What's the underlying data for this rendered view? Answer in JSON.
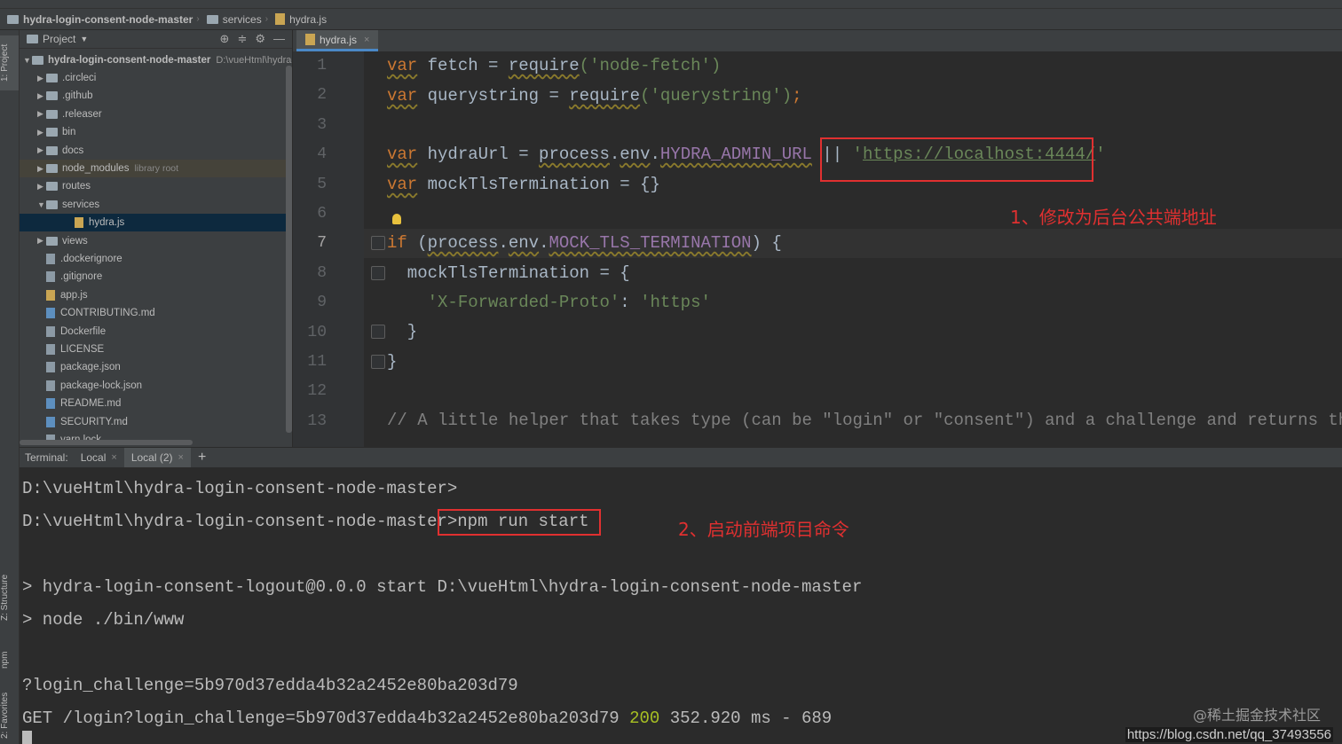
{
  "breadcrumb": {
    "project": "hydra-login-consent-node-master",
    "folder": "services",
    "file": "hydra.js"
  },
  "left_stripe": {
    "project_tab": "1: Project",
    "structure_tab": "Z: Structure",
    "npm_tab": "npm",
    "favorites_tab": "2: Favorites"
  },
  "project_panel": {
    "title": "Project",
    "root_name": "hydra-login-consent-node-master",
    "root_path": "D:\\vueHtml\\hydra-",
    "items": [
      {
        "label": ".circleci",
        "kind": "folder"
      },
      {
        "label": ".github",
        "kind": "folder"
      },
      {
        "label": ".releaser",
        "kind": "folder"
      },
      {
        "label": "bin",
        "kind": "folder"
      },
      {
        "label": "docs",
        "kind": "folder"
      },
      {
        "label": "node_modules",
        "kind": "folder",
        "note": "library root"
      },
      {
        "label": "routes",
        "kind": "folder"
      },
      {
        "label": "services",
        "kind": "folder"
      },
      {
        "label": "hydra.js",
        "kind": "js"
      },
      {
        "label": "views",
        "kind": "folder"
      },
      {
        "label": ".dockerignore",
        "kind": "file"
      },
      {
        "label": ".gitignore",
        "kind": "file"
      },
      {
        "label": "app.js",
        "kind": "js"
      },
      {
        "label": "CONTRIBUTING.md",
        "kind": "md"
      },
      {
        "label": "Dockerfile",
        "kind": "file"
      },
      {
        "label": "LICENSE",
        "kind": "file"
      },
      {
        "label": "package.json",
        "kind": "file"
      },
      {
        "label": "package-lock.json",
        "kind": "file"
      },
      {
        "label": "README.md",
        "kind": "md"
      },
      {
        "label": "SECURITY.md",
        "kind": "md"
      },
      {
        "label": "yarn.lock",
        "kind": "file"
      }
    ]
  },
  "editor": {
    "tab": "hydra.js",
    "line_numbers": [
      "1",
      "2",
      "3",
      "4",
      "5",
      "6",
      "7",
      "8",
      "9",
      "10",
      "11",
      "12",
      "13"
    ],
    "lines": {
      "l1_kw": "var",
      "l1_a": " fetch = ",
      "l1_fn": "require",
      "l1_str": "('node-fetch')",
      "l2_kw": "var",
      "l2_a": " querystring = ",
      "l2_fn": "require",
      "l2_str": "('querystring')",
      "l2_end": ";",
      "l4_kw": "var",
      "l4_a": " hydraUrl = ",
      "l4_p": "process",
      "l4_dot": ".",
      "l4_env": "env",
      "l4_const": "HYDRA_ADMIN_URL",
      "l4_or": " || ",
      "l4_q": "'",
      "l4_url": "https://localhost:4444/",
      "l5_kw": "var",
      "l5_a": " mockTlsTermination = {}",
      "l7_kw": "if",
      "l7_a": " (",
      "l7_p": "process",
      "l7_env": "env",
      "l7_const": "MOCK_TLS_TERMINATION",
      "l7_end": ") {",
      "l8": "  mockTlsTermination = {",
      "l9_key": "    'X-Forwarded-Proto'",
      "l9_colon": ": ",
      "l9_val": "'https'",
      "l10": "  }",
      "l11": "}",
      "l13": "// A little helper that takes type (can be \"login\" or \"consent\") and a challenge and returns the"
    }
  },
  "terminal": {
    "label": "Terminal:",
    "tabs": [
      "Local",
      "Local (2)"
    ],
    "add": "+",
    "lines": {
      "t1": "D:\\vueHtml\\hydra-login-consent-node-master>",
      "t2_prompt": "D:\\vueHtml\\hydra-login-consent-node-master>",
      "t2_cmd": "npm run start",
      "t3": "> hydra-login-consent-logout@0.0.0 start D:\\vueHtml\\hydra-login-consent-node-master",
      "t4": "> node ./bin/www",
      "t5": "?login_challenge=5b970d37edda4b32a2452e80ba203d79",
      "t6_a": "GET /login?login_challenge=5b970d37edda4b32a2452e80ba203d79 ",
      "t6_status": "200",
      "t6_b": " 352.920 ms - 689"
    }
  },
  "annotations": {
    "a1": "1、修改为后台公共端地址",
    "a2": "2、启动前端项目命令",
    "annotation_color": "#e03030"
  },
  "watermark": {
    "line1": "@稀土掘金技术社区",
    "line2": "https://blog.csdn.net/qq_37493556"
  }
}
